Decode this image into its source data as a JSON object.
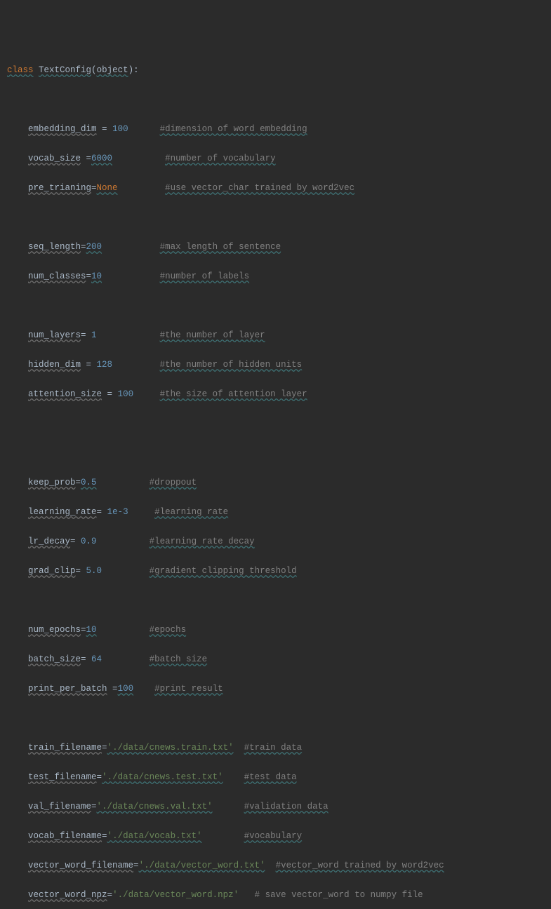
{
  "code": {
    "l0_kw": "class",
    "l0_name": "TextConfig",
    "l0_base": "object",
    "l0_colon": ":",
    "l2_prop": "embedding_dim",
    "l2_eq": " = ",
    "l2_val": "100",
    "l2_cmt": "#dimension of word embedding",
    "l3_prop": "vocab_size",
    "l3_eq": " =",
    "l3_val": "6000",
    "l3_cmt": "#number of vocabulary",
    "l4_prop": "pre_trianing",
    "l4_eq": "=",
    "l4_val": "None",
    "l4_cmt": "#use vector_char trained by word2vec",
    "l6_prop": "seq_length",
    "l6_eq": "=",
    "l6_val": "200",
    "l6_cmt": "#max length of sentence",
    "l7_prop": "num_classes",
    "l7_eq": "=",
    "l7_val": "10",
    "l7_cmt": "#number of labels",
    "l9_prop": "num_layers",
    "l9_eq": "= ",
    "l9_val": "1",
    "l9_cmt": "#the number of layer",
    "l10_prop": "hidden_dim",
    "l10_eq": " = ",
    "l10_val": "128",
    "l10_cmt": "#the number of hidden units",
    "l11_prop": "attention_size",
    "l11_eq": " = ",
    "l11_val": "100",
    "l11_cmt": "#the size of attention layer",
    "l14_prop": "keep_prob",
    "l14_eq": "=",
    "l14_val": "0.5",
    "l14_cmt": "#droppout",
    "l15_prop": "learning_rate",
    "l15_eq": "= ",
    "l15_val": "1e-3",
    "l15_cmt": "#learning rate",
    "l16_prop": "lr_decay",
    "l16_eq": "= ",
    "l16_val": "0.9",
    "l16_cmt": "#learning rate decay",
    "l17_prop": "grad_clip",
    "l17_eq": "= ",
    "l17_val": "5.0",
    "l17_cmt": "#gradient clipping threshold",
    "l19_prop": "num_epochs",
    "l19_eq": "=",
    "l19_val": "10",
    "l19_cmt": "#epochs",
    "l20_prop": "batch_size",
    "l20_eq": "= ",
    "l20_val": "64",
    "l20_cmt": "#batch size",
    "l21_prop": "print_per_batch",
    "l21_eq": " =",
    "l21_val": "100",
    "l21_cmt": "#print result",
    "l23_prop": "train_filename",
    "l23_eq": "=",
    "l23_val": "'./data/cnews.train.txt'",
    "l23_cmt": "#train data",
    "l24_prop": "test_filename",
    "l24_eq": "=",
    "l24_val": "'./data/cnews.test.txt'",
    "l24_cmt": "#test data",
    "l25_prop": "val_filename",
    "l25_eq": "=",
    "l25_val": "'./data/cnews.val.txt'",
    "l25_cmt": "#validation data",
    "l26_prop": "vocab_filename",
    "l26_eq": "=",
    "l26_val": "'./data/vocab.txt'",
    "l26_cmt": "#vocabulary",
    "l27_prop": "vector_word_filename",
    "l27_eq": "=",
    "l27_val": "'./data/vector_word.txt'",
    "l27_cmt": "#vector_word trained by word2vec",
    "l28_prop": "vector_word_npz",
    "l28_eq": "=",
    "l28_val": "'./data/vector_word.npz'",
    "l28_cmt": "# save vector_word to numpy file"
  }
}
